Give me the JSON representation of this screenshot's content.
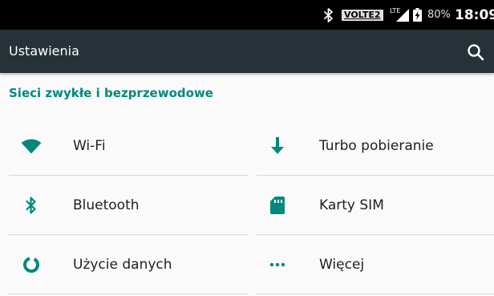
{
  "status_bar": {
    "volte_label": "VOLTE2",
    "network_type": "LTE",
    "battery_percent": "80%",
    "time": "18:09",
    "icons": [
      "bluetooth-icon",
      "signal-icon",
      "battery-charging-icon"
    ]
  },
  "toolbar": {
    "title": "Ustawienia",
    "search_icon": "search-icon",
    "background_color": "#263238"
  },
  "section": {
    "title": "Sieci zwykłe i bezprzewodowe",
    "accent_color": "#00897b"
  },
  "tiles": [
    {
      "label": "Wi-Fi",
      "icon": "wifi-icon"
    },
    {
      "label": "Turbo pobieranie",
      "icon": "download-arrow-icon"
    },
    {
      "label": "Bluetooth",
      "icon": "bluetooth-icon"
    },
    {
      "label": "Karty SIM",
      "icon": "sim-card-icon"
    },
    {
      "label": "Użycie danych",
      "icon": "data-usage-icon"
    },
    {
      "label": "Więcej",
      "icon": "more-dots-icon"
    }
  ]
}
